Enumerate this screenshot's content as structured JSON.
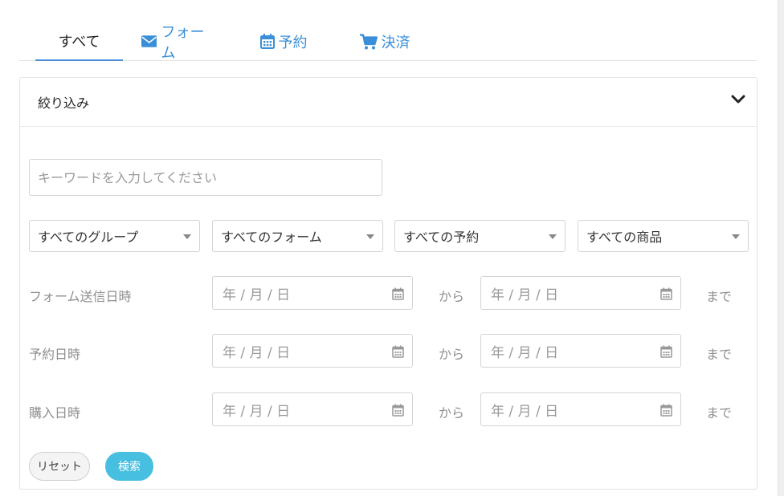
{
  "tabs": [
    {
      "label": "すべて",
      "icon": "none",
      "active": true
    },
    {
      "label": "フォーム",
      "icon": "envelope-icon",
      "active": false
    },
    {
      "label": "予約",
      "icon": "calendar-icon",
      "active": false
    },
    {
      "label": "決済",
      "icon": "cart-icon",
      "active": false
    }
  ],
  "colors": {
    "accent": "#3a8fd8",
    "search_button": "#47bfe0"
  },
  "filter": {
    "title": "絞り込み",
    "keyword_placeholder": "キーワードを入力してください",
    "keyword_value": "",
    "selects": [
      {
        "value": "すべてのグループ"
      },
      {
        "value": "すべてのフォーム"
      },
      {
        "value": "すべての予約"
      },
      {
        "value": "すべての商品"
      }
    ],
    "date_placeholder": "年 / 月 / 日",
    "from_label": "から",
    "to_label": "まで",
    "date_rows": [
      {
        "label": "フォーム送信日時"
      },
      {
        "label": "予約日時"
      },
      {
        "label": "購入日時"
      }
    ],
    "reset_label": "リセット",
    "search_label": "検索"
  }
}
